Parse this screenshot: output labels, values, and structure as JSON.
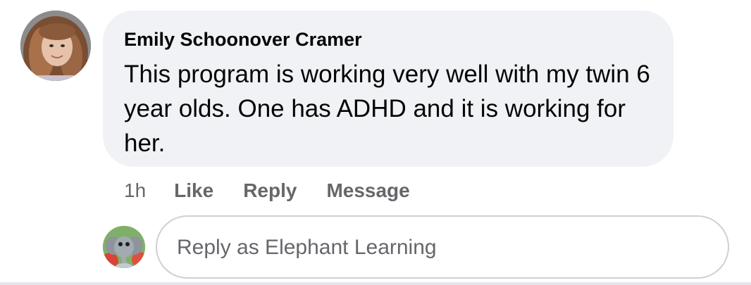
{
  "comment": {
    "author": "Emily Schoonover Cramer",
    "text": "This program is working very well with my twin 6 year olds. One has ADHD and it is working for her.",
    "timestamp": "1h",
    "actions": {
      "like": "Like",
      "reply": "Reply",
      "message": "Message"
    },
    "avatar_icon": "user-profile-photo"
  },
  "reply_box": {
    "placeholder": "Reply as Elephant Learning",
    "avatar_icon": "elephant-learning-avatar"
  },
  "colors": {
    "bubble_bg": "#f0f2f5",
    "text_primary": "#050505",
    "text_secondary": "#65676b",
    "input_border": "#ced0d4"
  }
}
